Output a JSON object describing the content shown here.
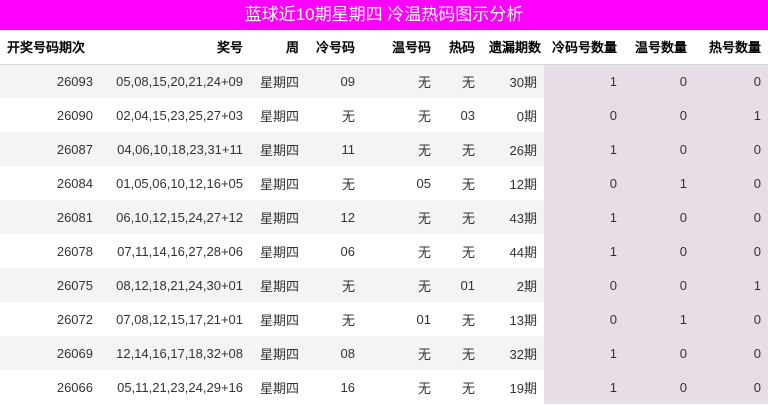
{
  "title": "蓝球近10期星期四 冷温热码图示分析",
  "headers": [
    "开奖号码期次",
    "奖号",
    "周",
    "冷号码",
    "温号码",
    "热码",
    "遗漏期数",
    "冷码号数量",
    "温号数量",
    "热号数量"
  ],
  "rows": [
    [
      "26093",
      "05,08,15,20,21,24+09",
      "星期四",
      "09",
      "无",
      "无",
      "30期",
      "1",
      "0",
      "0"
    ],
    [
      "26090",
      "02,04,15,23,25,27+03",
      "星期四",
      "无",
      "无",
      "03",
      "0期",
      "0",
      "0",
      "1"
    ],
    [
      "26087",
      "04,06,10,18,23,31+11",
      "星期四",
      "11",
      "无",
      "无",
      "26期",
      "1",
      "0",
      "0"
    ],
    [
      "26084",
      "01,05,06,10,12,16+05",
      "星期四",
      "无",
      "05",
      "无",
      "12期",
      "0",
      "1",
      "0"
    ],
    [
      "26081",
      "06,10,12,15,24,27+12",
      "星期四",
      "12",
      "无",
      "无",
      "43期",
      "1",
      "0",
      "0"
    ],
    [
      "26078",
      "07,11,14,16,27,28+06",
      "星期四",
      "06",
      "无",
      "无",
      "44期",
      "1",
      "0",
      "0"
    ],
    [
      "26075",
      "08,12,18,21,24,30+01",
      "星期四",
      "无",
      "无",
      "01",
      "2期",
      "0",
      "0",
      "1"
    ],
    [
      "26072",
      "07,08,12,15,17,21+01",
      "星期四",
      "无",
      "01",
      "无",
      "13期",
      "0",
      "1",
      "0"
    ],
    [
      "26069",
      "12,14,16,17,18,32+08",
      "星期四",
      "08",
      "无",
      "无",
      "32期",
      "1",
      "0",
      "0"
    ],
    [
      "26066",
      "05,11,21,23,24,29+16",
      "星期四",
      "16",
      "无",
      "无",
      "19期",
      "1",
      "0",
      "0"
    ]
  ]
}
